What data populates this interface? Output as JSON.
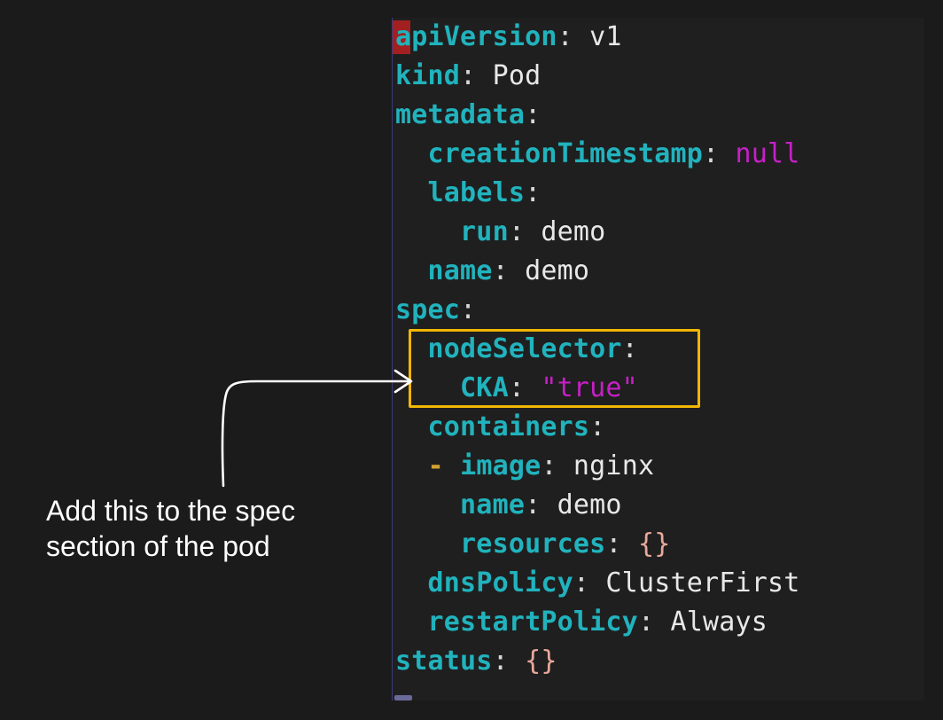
{
  "annotation": {
    "line1": "Add this to the spec",
    "line2": "section of the pod"
  },
  "yaml": {
    "apiVersion_key": "apiVersion",
    "apiVersion_val": "v1",
    "kind_key": "kind",
    "kind_val": "Pod",
    "metadata_key": "metadata",
    "creationTimestamp_key": "creationTimestamp",
    "creationTimestamp_val": "null",
    "labels_key": "labels",
    "run_key": "run",
    "run_val": "demo",
    "name_key": "name",
    "name_val": "demo",
    "spec_key": "spec",
    "nodeSelector_key": "nodeSelector",
    "cka_key": "CKA",
    "cka_val": "\"true\"",
    "containers_key": "containers",
    "dash": "-",
    "image_key": "image",
    "image_val": "nginx",
    "cname_key": "name",
    "cname_val": "demo",
    "resources_key": "resources",
    "resources_val": "{}",
    "dnsPolicy_key": "dnsPolicy",
    "dnsPolicy_val": "ClusterFirst",
    "restartPolicy_key": "restartPolicy",
    "restartPolicy_val": "Always",
    "status_key": "status",
    "status_val": "{}",
    "colon": ":"
  },
  "colors": {
    "key": "#21b3bd",
    "string": "#c71fc7",
    "highlight_box": "#f2b705",
    "background": "#1b1b1b"
  }
}
